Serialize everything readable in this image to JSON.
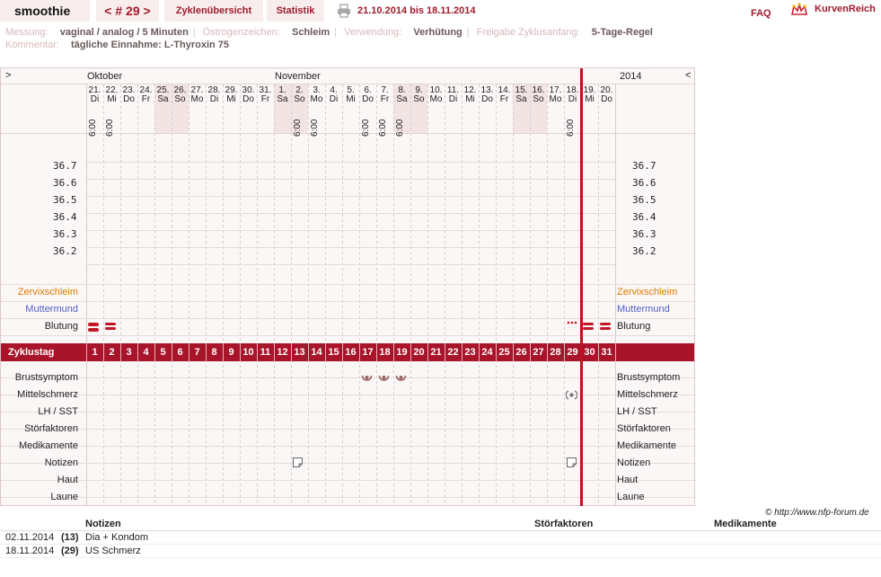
{
  "header": {
    "title": "smoothie",
    "nav": "< # 29 >",
    "tabs": [
      "Zyklenübersicht",
      "Statistik"
    ],
    "print_icon": "printer-icon",
    "range": "21.10.2014 bis 18.11.2014",
    "faq": "FAQ",
    "brand": "KurvenReich",
    "brand_icon": "crown-icon"
  },
  "meta": {
    "row1": [
      {
        "label": "Messung:",
        "value": "vaginal / analog / 5 Minuten"
      },
      {
        "label": "Östrogenzeichen:",
        "value": "Schleim"
      },
      {
        "label": "Verwendung:",
        "value": "Verhütung"
      },
      {
        "label": "Freigabe Zyklusanfang:",
        "value": "5-Tage-Regel"
      }
    ],
    "row2": {
      "label": "Kommentar:",
      "value": "tägliche Einnahme: L-Thyroxin 75"
    }
  },
  "chart": {
    "toggle_left": ">",
    "toggle_right": "<",
    "year": "2014",
    "months": [
      "Oktober",
      "November"
    ],
    "days": [
      {
        "d": "21.",
        "w": "Di",
        "t": "6:00"
      },
      {
        "d": "22.",
        "w": "Mi",
        "t": "6:00"
      },
      {
        "d": "23.",
        "w": "Do",
        "t": ""
      },
      {
        "d": "24.",
        "w": "Fr",
        "t": ""
      },
      {
        "d": "25.",
        "w": "Sa",
        "t": ""
      },
      {
        "d": "26.",
        "w": "So",
        "t": ""
      },
      {
        "d": "27.",
        "w": "Mo",
        "t": ""
      },
      {
        "d": "28.",
        "w": "Di",
        "t": ""
      },
      {
        "d": "29.",
        "w": "Mi",
        "t": ""
      },
      {
        "d": "30.",
        "w": "Do",
        "t": ""
      },
      {
        "d": "31.",
        "w": "Fr",
        "t": ""
      },
      {
        "d": "1.",
        "w": "Sa",
        "t": ""
      },
      {
        "d": "2.",
        "w": "So",
        "t": "6:00"
      },
      {
        "d": "3.",
        "w": "Mo",
        "t": "6:00"
      },
      {
        "d": "4.",
        "w": "Di",
        "t": ""
      },
      {
        "d": "5.",
        "w": "Mi",
        "t": ""
      },
      {
        "d": "6.",
        "w": "Do",
        "t": "6:00"
      },
      {
        "d": "7.",
        "w": "Fr",
        "t": "6:00"
      },
      {
        "d": "8.",
        "w": "Sa",
        "t": "6:00"
      },
      {
        "d": "9.",
        "w": "So",
        "t": ""
      },
      {
        "d": "10.",
        "w": "Mo",
        "t": ""
      },
      {
        "d": "11.",
        "w": "Di",
        "t": ""
      },
      {
        "d": "12.",
        "w": "Mi",
        "t": ""
      },
      {
        "d": "13.",
        "w": "Do",
        "t": ""
      },
      {
        "d": "14.",
        "w": "Fr",
        "t": ""
      },
      {
        "d": "15.",
        "w": "Sa",
        "t": ""
      },
      {
        "d": "16.",
        "w": "So",
        "t": ""
      },
      {
        "d": "17.",
        "w": "Mo",
        "t": ""
      },
      {
        "d": "18.",
        "w": "Di",
        "t": "6:00"
      },
      {
        "d": "19.",
        "w": "Mi",
        "t": ""
      },
      {
        "d": "20.",
        "w": "Do",
        "t": ""
      }
    ],
    "temps": [
      "36.7",
      "36.6",
      "36.5",
      "36.4",
      "36.3",
      "36.2"
    ],
    "rows_top": [
      "Zervixschleim",
      "Muttermund",
      "Blutung"
    ],
    "cycle_label": "Zyklustag",
    "cycle_days": [
      "1",
      "2",
      "3",
      "4",
      "5",
      "6",
      "7",
      "8",
      "9",
      "10",
      "11",
      "12",
      "13",
      "14",
      "15",
      "16",
      "17",
      "18",
      "19",
      "20",
      "21",
      "22",
      "23",
      "24",
      "25",
      "26",
      "27",
      "28",
      "29",
      "30",
      "31"
    ],
    "rows_bottom": [
      "Brustsymptom",
      "Mittelschmerz",
      "LH / SST",
      "Störfaktoren",
      "Medikamente",
      "Notizen",
      "Haut",
      "Laune"
    ],
    "copyright": "© http://www.nfp-forum.de"
  },
  "notes": {
    "headers": [
      "Notizen",
      "Störfaktoren",
      "Medikamente"
    ],
    "entries": [
      {
        "date": "02.11.2014",
        "day": "(13)",
        "text": "Dia + Kondom"
      },
      {
        "date": "18.11.2014",
        "day": "(29)",
        "text": "US Schmerz"
      }
    ]
  },
  "colors": {
    "accent": "#b0202c",
    "tab_bg": "#f7eded",
    "weekend": "#f0e0e0",
    "orange": "#e07b00",
    "blue": "#5060c8"
  }
}
